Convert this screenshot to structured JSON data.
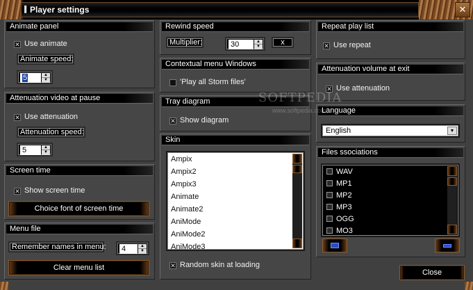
{
  "window": {
    "title": "Player settings"
  },
  "animate_panel": {
    "title": "Animate panel",
    "use_label": "Use animate",
    "speed_label": "Animate speed:",
    "speed_value": "5"
  },
  "attenuation_video": {
    "title": "Attenuation video at pause",
    "use_label": "Use attenuation",
    "speed_label": "Attenuation speed:",
    "speed_value": "5"
  },
  "screen_time": {
    "title": "Screen time",
    "show_label": "Show screen time",
    "font_button": "Choice font of screen time"
  },
  "menu_file": {
    "title": "Menu file",
    "remember_label": "Remember names in menu:",
    "remember_value": "4",
    "clear_button": "Clear menu list"
  },
  "rewind_speed": {
    "title": "Rewind speed",
    "multiplier_label": "Multiplier:",
    "multiplier_value": "30",
    "x_label": "x"
  },
  "contextual_menu": {
    "title": "Contextual menu Windows",
    "play_all_label": "'Play all Storm files'"
  },
  "tray_diagram": {
    "title": "Tray diagram",
    "show_label": "Show diagram"
  },
  "skin": {
    "title": "Skin",
    "items": [
      "Ampix",
      "Ampix2",
      "Ampix3",
      "Animate",
      "Animate2",
      "AniMode",
      "AniMode2",
      "AniMode3"
    ],
    "random_label": "Random skin at loading"
  },
  "repeat_playlist": {
    "title": "Repeat play list",
    "use_label": "Use repeat"
  },
  "attenuation_exit": {
    "title": "Attenuation volume at exit",
    "use_label": "Use attenuation"
  },
  "language": {
    "title": "Language",
    "selected": "English"
  },
  "files_associations": {
    "title": "Files ssociations",
    "items": [
      "WAV",
      "MP1",
      "MP2",
      "MP3",
      "OGG",
      "MO3"
    ]
  },
  "footer": {
    "close_button": "Close"
  },
  "watermark": {
    "brand": "SOFTPEDIA",
    "url": "www.softpedia.com"
  },
  "theme": {
    "accent_wood": "#a0683a",
    "panel_bg": "#464646",
    "header_bg": "#000000",
    "list_bg": "#ffffff",
    "icon_blue": "#2a4acc"
  },
  "icons": {
    "check": "check-icon",
    "spin_up": "arrow-up-icon",
    "spin_down": "arrow-down-icon",
    "add": "add-icon",
    "remove": "remove-icon"
  }
}
